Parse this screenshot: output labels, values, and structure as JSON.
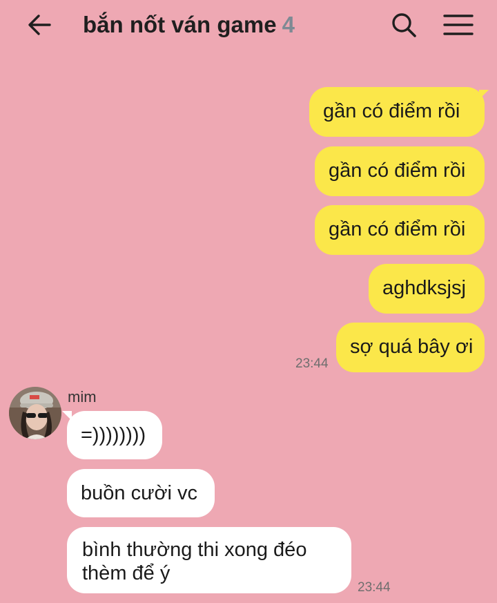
{
  "header": {
    "title": "bắn nốt ván game",
    "member_count": "4",
    "icons": [
      "back-arrow-icon",
      "search-icon",
      "hamburger-menu-icon"
    ]
  },
  "messages_out": [
    {
      "text": "gần có điểm rồi"
    },
    {
      "text": "gần có điểm rồi"
    },
    {
      "text": "gần có điểm rồi"
    },
    {
      "text": "aghdksjsj"
    },
    {
      "text": "sợ quá bây ơi",
      "time": "23:44"
    }
  ],
  "sender": {
    "name": "mim"
  },
  "messages_in": [
    {
      "text": "=))))))))"
    },
    {
      "text": "buồn cười vc"
    },
    {
      "text": "bình thường thi xong đéo thèm để ý",
      "time": "23:44"
    }
  ],
  "colors": {
    "background": "#eea8b3",
    "outgoing_bubble": "#fbe74a",
    "incoming_bubble": "#ffffff"
  }
}
